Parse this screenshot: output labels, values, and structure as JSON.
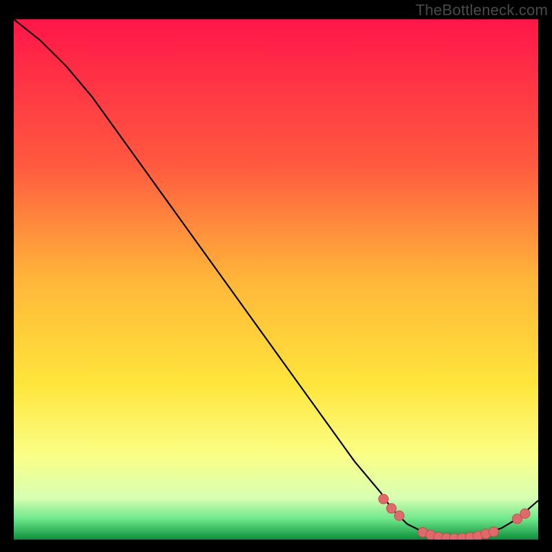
{
  "watermark": "TheBottleneck.com",
  "colors": {
    "bg": "#000000",
    "curve": "#000000",
    "marker_fill": "#e06a6b",
    "marker_stroke": "#c94a4c",
    "gradient_top": "#ff1649",
    "gradient_mid_upper": "#ff7a3a",
    "gradient_mid": "#ffe53b",
    "gradient_mid_lower": "#f9ff7a",
    "gradient_green": "#2fe36b",
    "gradient_bottom": "#0a8f3a"
  },
  "chart_data": {
    "type": "line",
    "title": "",
    "xlabel": "",
    "ylabel": "",
    "xlim": [
      0,
      100
    ],
    "ylim": [
      0,
      100
    ],
    "x": [
      0,
      5,
      10,
      15,
      20,
      25,
      30,
      35,
      40,
      45,
      50,
      55,
      60,
      65,
      70,
      72,
      75,
      78,
      80,
      83,
      85,
      88,
      90,
      93,
      96,
      100
    ],
    "y": [
      100,
      96,
      91,
      85,
      78,
      71,
      64,
      57,
      50,
      43,
      36,
      29,
      22,
      15,
      9,
      6,
      3,
      1.5,
      0.6,
      0.2,
      0.3,
      0.6,
      1.2,
      2.2,
      4.0,
      7.5
    ],
    "markers": {
      "x": [
        70.5,
        72.0,
        73.5,
        78.0,
        79.5,
        81.0,
        82.5,
        84.0,
        85.5,
        87.0,
        88.5,
        90.0,
        91.5,
        96.0,
        97.5
      ],
      "y": [
        7.8,
        6.0,
        4.6,
        1.4,
        0.9,
        0.5,
        0.3,
        0.25,
        0.3,
        0.45,
        0.7,
        1.1,
        1.5,
        4.0,
        5.0
      ]
    }
  }
}
